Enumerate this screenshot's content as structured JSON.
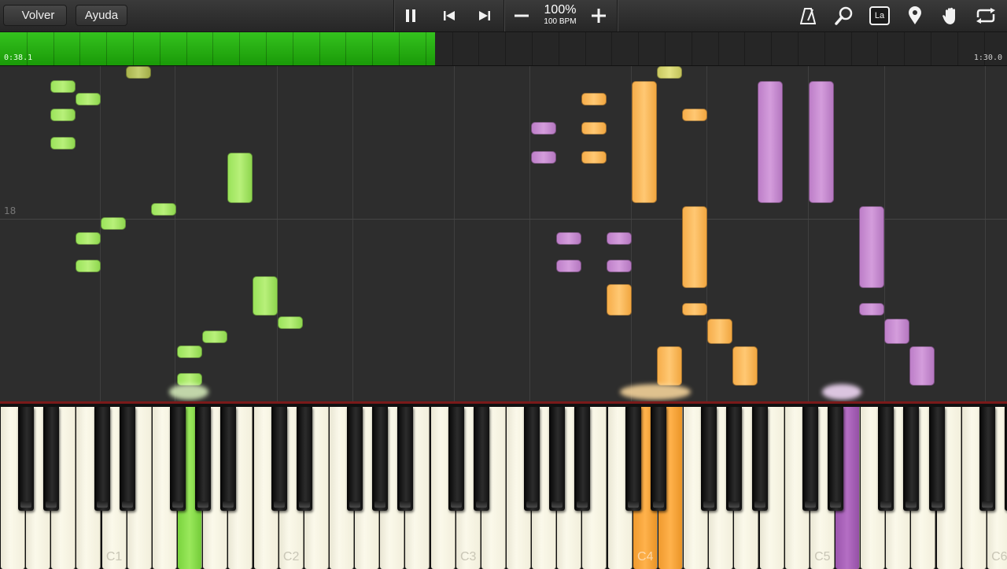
{
  "toolbar": {
    "back_label": "Volver",
    "help_label": "Ayuda",
    "speed_percent": "100%",
    "speed_bpm": "100 BPM",
    "icons": [
      "pause-icon",
      "skip-back-icon",
      "skip-forward-icon",
      "minus-icon",
      "plus-icon",
      "metronome-icon",
      "magnifier-icon",
      "key-label-icon",
      "location-pin-icon",
      "hand-icon",
      "loop-icon"
    ],
    "key_label_icon_text": "La"
  },
  "progress": {
    "current_time": "0:38.1",
    "total_time": "1:30.0",
    "fraction": 0.432,
    "color": "#2bb414"
  },
  "roll": {
    "measure_number": "18"
  },
  "keyboard": {
    "octave_labels": [
      "C1",
      "C2",
      "C3",
      "C4",
      "C5",
      "C6"
    ],
    "track_colors": {
      "left_hand": "#9ae35a",
      "right_hand_a": "#ffb95f",
      "right_hand_b": "#c88ad3"
    }
  }
}
